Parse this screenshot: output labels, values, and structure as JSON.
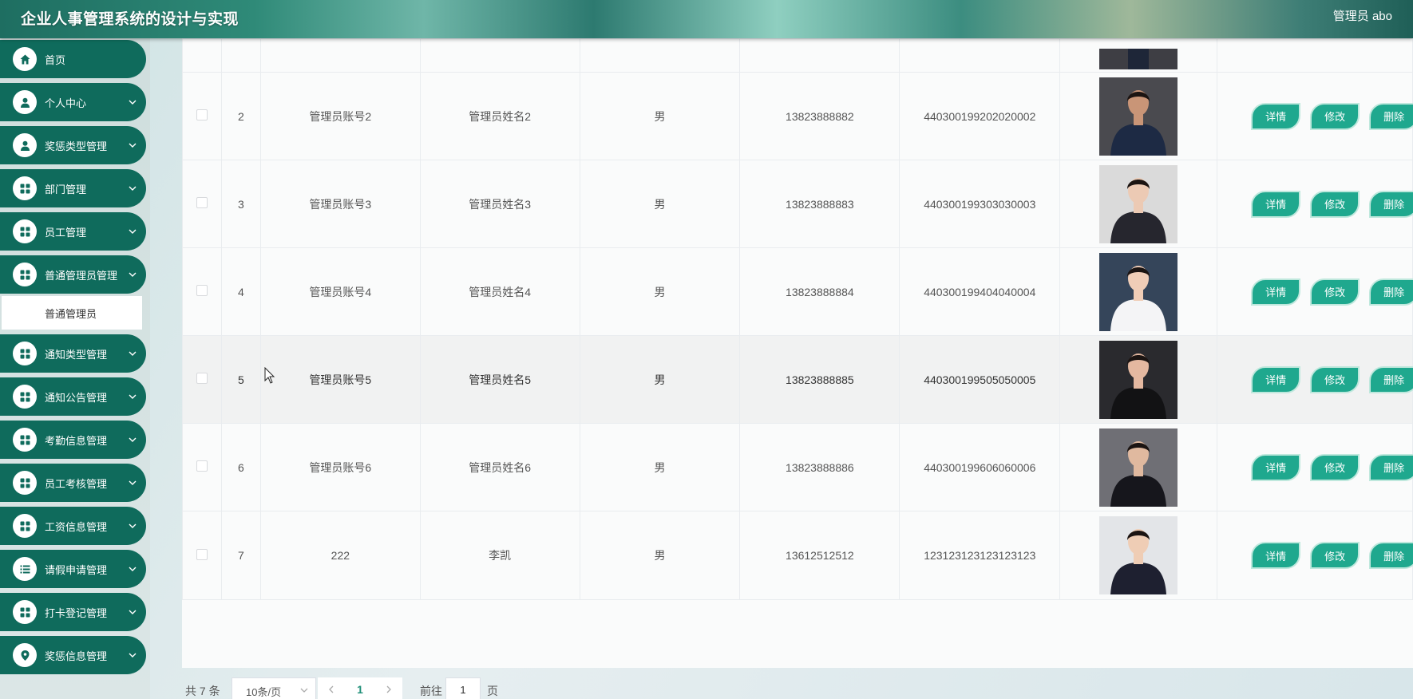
{
  "header": {
    "title": "企业人事管理系统的设计与实现",
    "user": "管理员 abo"
  },
  "sidebar": {
    "items": [
      {
        "label": "首页",
        "icon": "home-icon",
        "has_arrow": false
      },
      {
        "label": "个人中心",
        "icon": "user-icon",
        "has_arrow": true
      },
      {
        "label": "奖惩类型管理",
        "icon": "user-icon",
        "has_arrow": true
      },
      {
        "label": "部门管理",
        "icon": "grid-icon",
        "has_arrow": true
      },
      {
        "label": "员工管理",
        "icon": "grid-icon",
        "has_arrow": true
      },
      {
        "label": "普通管理员管理",
        "icon": "grid-icon",
        "has_arrow": true
      },
      {
        "label": "通知类型管理",
        "icon": "grid-icon",
        "has_arrow": true
      },
      {
        "label": "通知公告管理",
        "icon": "grid-icon",
        "has_arrow": true
      },
      {
        "label": "考勤信息管理",
        "icon": "grid-icon",
        "has_arrow": true
      },
      {
        "label": "员工考核管理",
        "icon": "grid-icon",
        "has_arrow": true
      },
      {
        "label": "工资信息管理",
        "icon": "grid-icon",
        "has_arrow": true
      },
      {
        "label": "请假申请管理",
        "icon": "list-icon",
        "has_arrow": true
      },
      {
        "label": "打卡登记管理",
        "icon": "grid-icon",
        "has_arrow": true
      },
      {
        "label": "奖惩信息管理",
        "icon": "location-pin-icon",
        "has_arrow": true
      }
    ],
    "submenu": {
      "label": "普通管理员"
    }
  },
  "table": {
    "actions": {
      "detail": "详情",
      "edit": "修改",
      "delete": "删除"
    },
    "rows": [
      {
        "index": "2",
        "account": "管理员账号2",
        "name": "管理员姓名2",
        "gender": "男",
        "phone": "13823888882",
        "id_number": "440300199202020002"
      },
      {
        "index": "3",
        "account": "管理员账号3",
        "name": "管理员姓名3",
        "gender": "男",
        "phone": "13823888883",
        "id_number": "440300199303030003"
      },
      {
        "index": "4",
        "account": "管理员账号4",
        "name": "管理员姓名4",
        "gender": "男",
        "phone": "13823888884",
        "id_number": "440300199404040004"
      },
      {
        "index": "5",
        "account": "管理员账号5",
        "name": "管理员姓名5",
        "gender": "男",
        "phone": "13823888885",
        "id_number": "440300199505050005"
      },
      {
        "index": "6",
        "account": "管理员账号6",
        "name": "管理员姓名6",
        "gender": "男",
        "phone": "13823888886",
        "id_number": "440300199606060006"
      },
      {
        "index": "7",
        "account": "222",
        "name": "李凯",
        "gender": "男",
        "phone": "13612512512",
        "id_number": "123123123123123123"
      }
    ]
  },
  "pagination": {
    "total": "共 7 条",
    "page_size": "10条/页",
    "current_page": "1",
    "goto_label": "前往",
    "goto_value": "1",
    "unit": "页"
  },
  "colors": {
    "menu_bg": "#0f6b5c",
    "button_bg": "#1fa88e",
    "accent": "#1f8f78"
  }
}
